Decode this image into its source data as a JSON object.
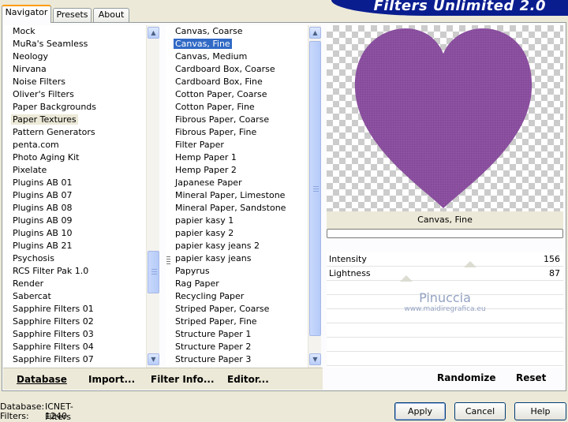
{
  "app_title": "Filters Unlimited 2.0",
  "tabs": [
    {
      "label": "Navigator",
      "active": true
    },
    {
      "label": "Presets",
      "active": false
    },
    {
      "label": "About",
      "active": false
    }
  ],
  "categories": [
    "Mock",
    "MuRa's Seamless",
    "Neology",
    "Nirvana",
    "Noise Filters",
    "Oliver's Filters",
    "Paper Backgrounds",
    "Paper Textures",
    "Pattern Generators",
    "penta.com",
    "Photo Aging Kit",
    "Pixelate",
    "Plugins AB 01",
    "Plugins AB 07",
    "Plugins AB 08",
    "Plugins AB 09",
    "Plugins AB 10",
    "Plugins AB 21",
    "Psychosis",
    "RCS Filter Pak 1.0",
    "Render",
    "Sabercat",
    "Sapphire Filters 01",
    "Sapphire Filters 02",
    "Sapphire Filters 03",
    "Sapphire Filters 04",
    "Sapphire Filters 07"
  ],
  "selected_category": "Paper Textures",
  "filters": [
    "Canvas, Coarse",
    "Canvas, Fine",
    "Canvas, Medium",
    "Cardboard Box, Coarse",
    "Cardboard Box, Fine",
    "Cotton Paper, Coarse",
    "Cotton Paper, Fine",
    "Fibrous Paper, Coarse",
    "Fibrous Paper, Fine",
    "Filter Paper",
    "Hemp Paper 1",
    "Hemp Paper 2",
    "Japanese Paper",
    "Mineral Paper, Limestone",
    "Mineral Paper, Sandstone",
    "papier kasy 1",
    "papier kasy 2",
    "papier kasy jeans 2",
    "papier kasy jeans",
    "Papyrus",
    "Rag Paper",
    "Recycling Paper",
    "Striped Paper, Coarse",
    "Striped Paper, Fine",
    "Structure Paper 1",
    "Structure Paper 2",
    "Structure Paper 3"
  ],
  "selected_filter": "Canvas, Fine",
  "current_filter_name": "Canvas, Fine",
  "bottom_left_buttons": {
    "database": "Database",
    "import": "Import...",
    "filter_info": "Filter Info...",
    "editor": "Editor..."
  },
  "params": [
    {
      "label": "Intensity",
      "value": "156"
    },
    {
      "label": "Lightness",
      "value": "87"
    }
  ],
  "watermark": {
    "name": "Pinuccia",
    "site": "www.maidiregrafica.eu"
  },
  "right_buttons": {
    "randomize": "Randomize",
    "reset": "Reset"
  },
  "status": {
    "database_label": "Database:",
    "database_value": "ICNET-Filters",
    "filters_label": "Filters:",
    "filters_value": "1240"
  },
  "dialog_buttons": {
    "apply": "Apply",
    "cancel": "Cancel",
    "help": "Help"
  },
  "colors": {
    "banner": "#0a1d8f",
    "heart": "#8a4f9e",
    "selection": "#316ac5"
  }
}
